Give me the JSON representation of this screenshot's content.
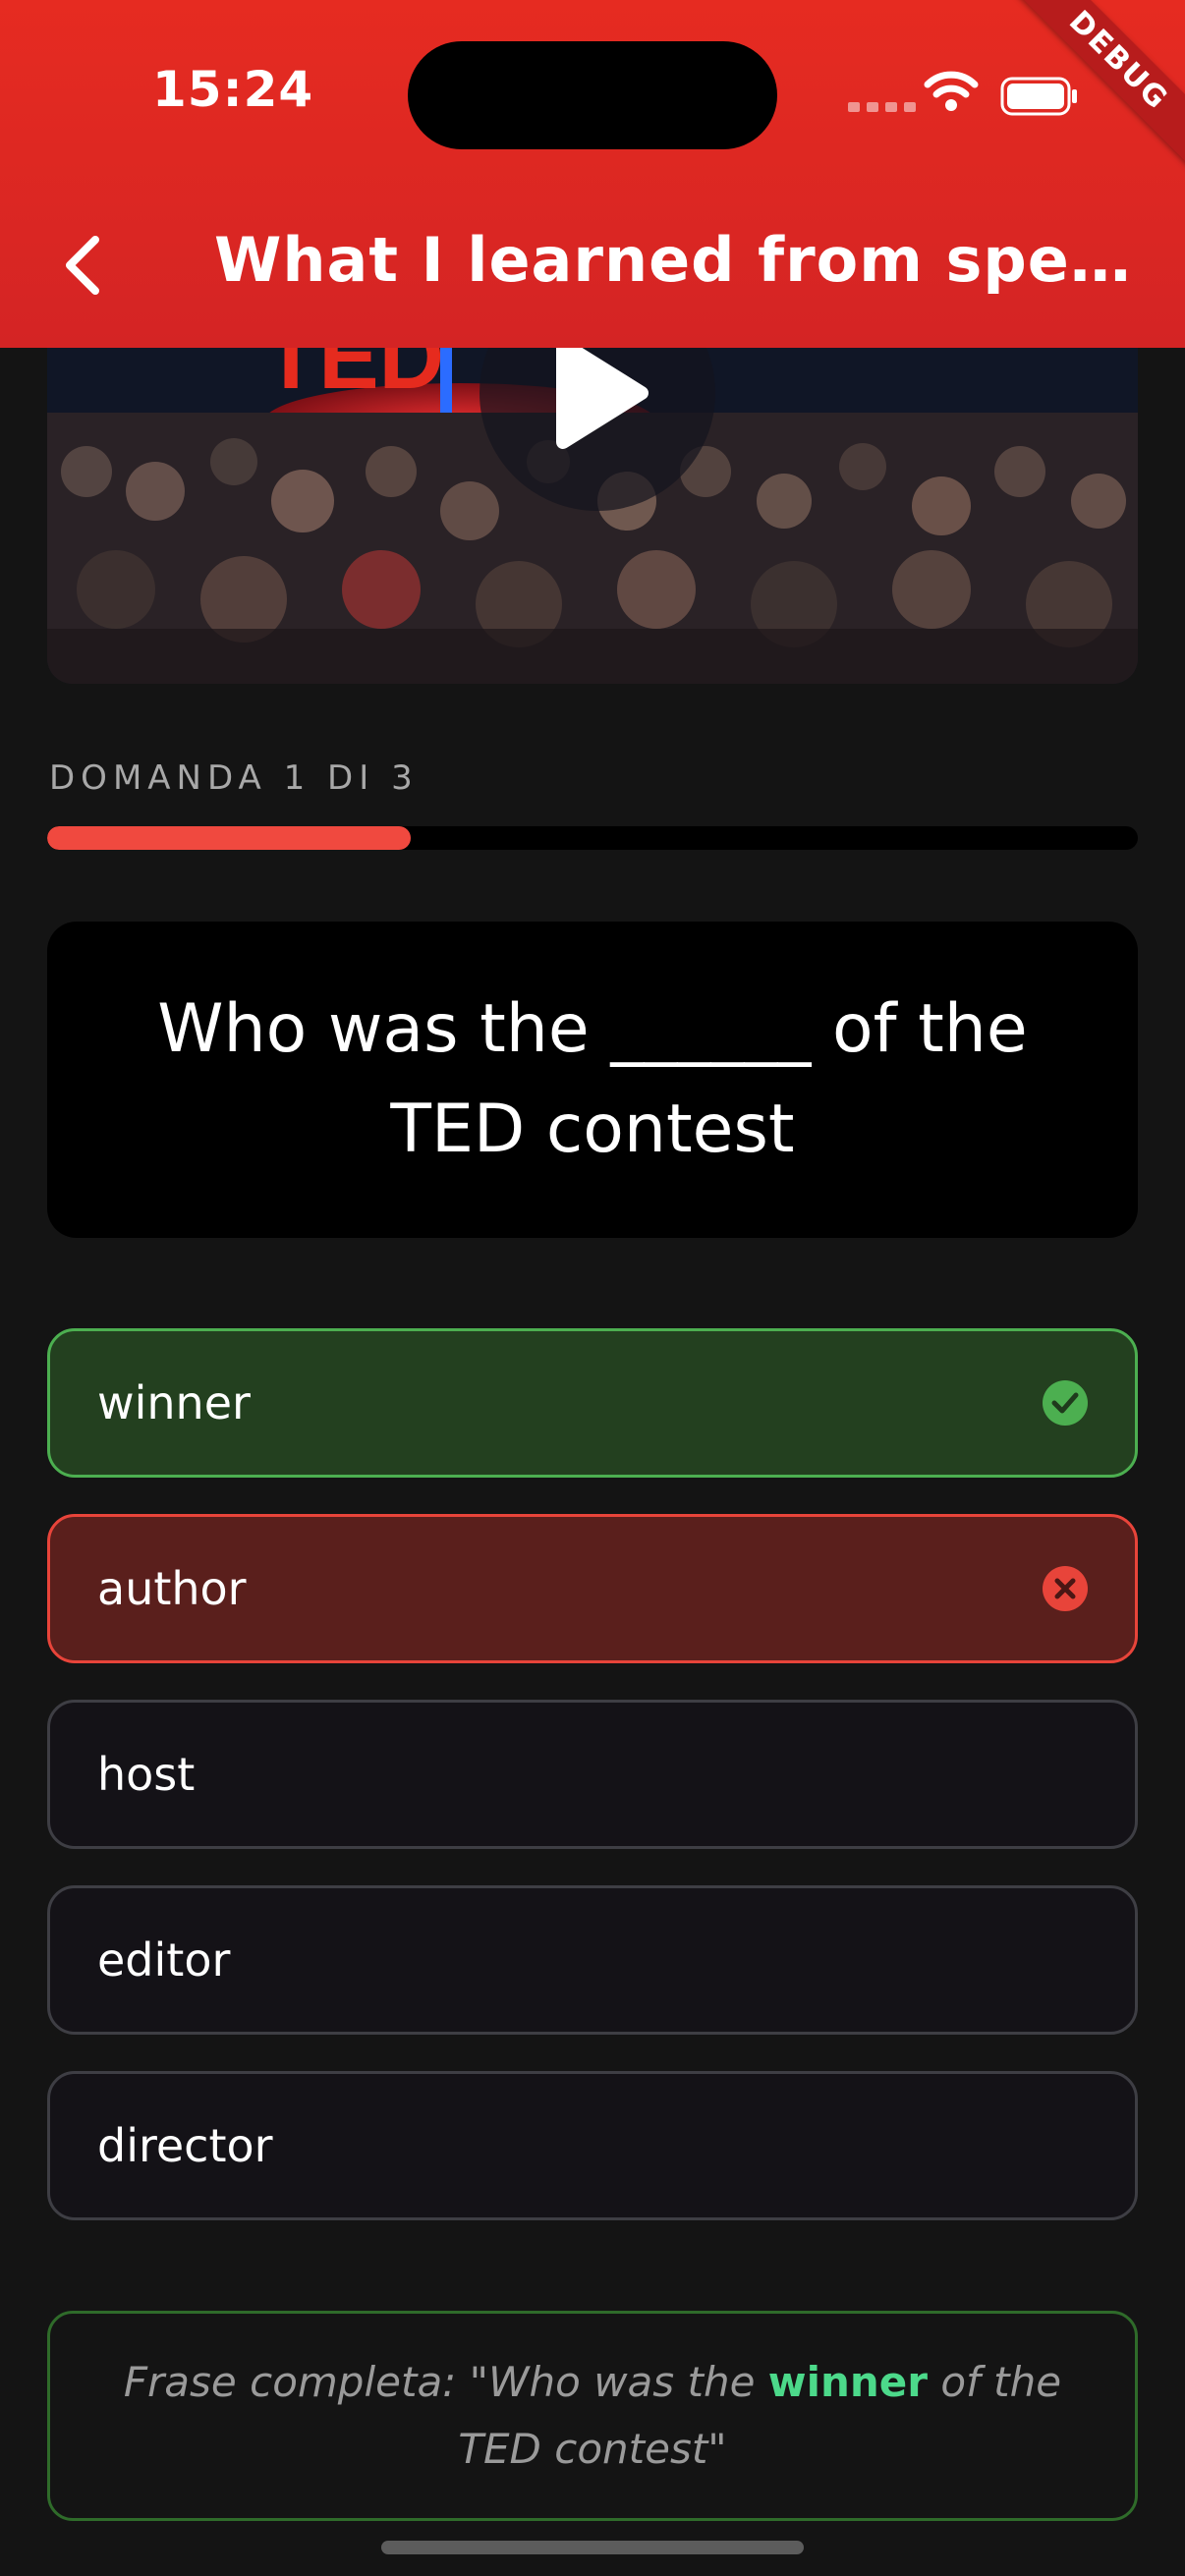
{
  "status_bar": {
    "time": "15:24"
  },
  "debug_banner": "DEBUG",
  "app_bar": {
    "title": "What I learned from spen..."
  },
  "video": {
    "logo_text": "TED"
  },
  "quiz": {
    "progress_label": "DOMANDA 1 DI 3",
    "progress": 0.333,
    "question": "Who was the ______ of the TED contest",
    "options": [
      {
        "label": "winner",
        "state": "correct",
        "icon": "check-circle-icon"
      },
      {
        "label": "author",
        "state": "wrong",
        "icon": "x-circle-icon"
      },
      {
        "label": "host",
        "state": "default"
      },
      {
        "label": "editor",
        "state": "default"
      },
      {
        "label": "director",
        "state": "default"
      }
    ],
    "feedback": {
      "prefix": "Frase completa: \"Who was the ",
      "answer": "winner",
      "suffix": " of the TED contest\""
    }
  },
  "colors": {
    "app_bar": "#e62b21",
    "background": "#141414",
    "correct": "#4caf50",
    "wrong": "#e8443a",
    "progress": "#f0493f",
    "answer_highlight": "#4cd98a"
  }
}
